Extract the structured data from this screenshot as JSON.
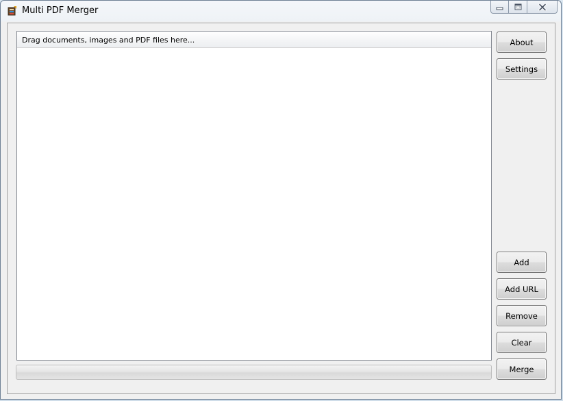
{
  "window": {
    "title": "Multi PDF Merger"
  },
  "list": {
    "header": "Drag documents, images and PDF files here...",
    "items": []
  },
  "buttons": {
    "about": "About",
    "settings": "Settings",
    "add": "Add",
    "add_url": "Add URL",
    "remove": "Remove",
    "clear": "Clear",
    "merge": "Merge"
  },
  "progress": {
    "value": 0
  },
  "icons": {
    "app": "pdf-document-icon",
    "minimize": "minimize-icon",
    "maximize": "maximize-icon",
    "close": "close-icon"
  },
  "colors": {
    "progress_fill": "#06b025"
  }
}
